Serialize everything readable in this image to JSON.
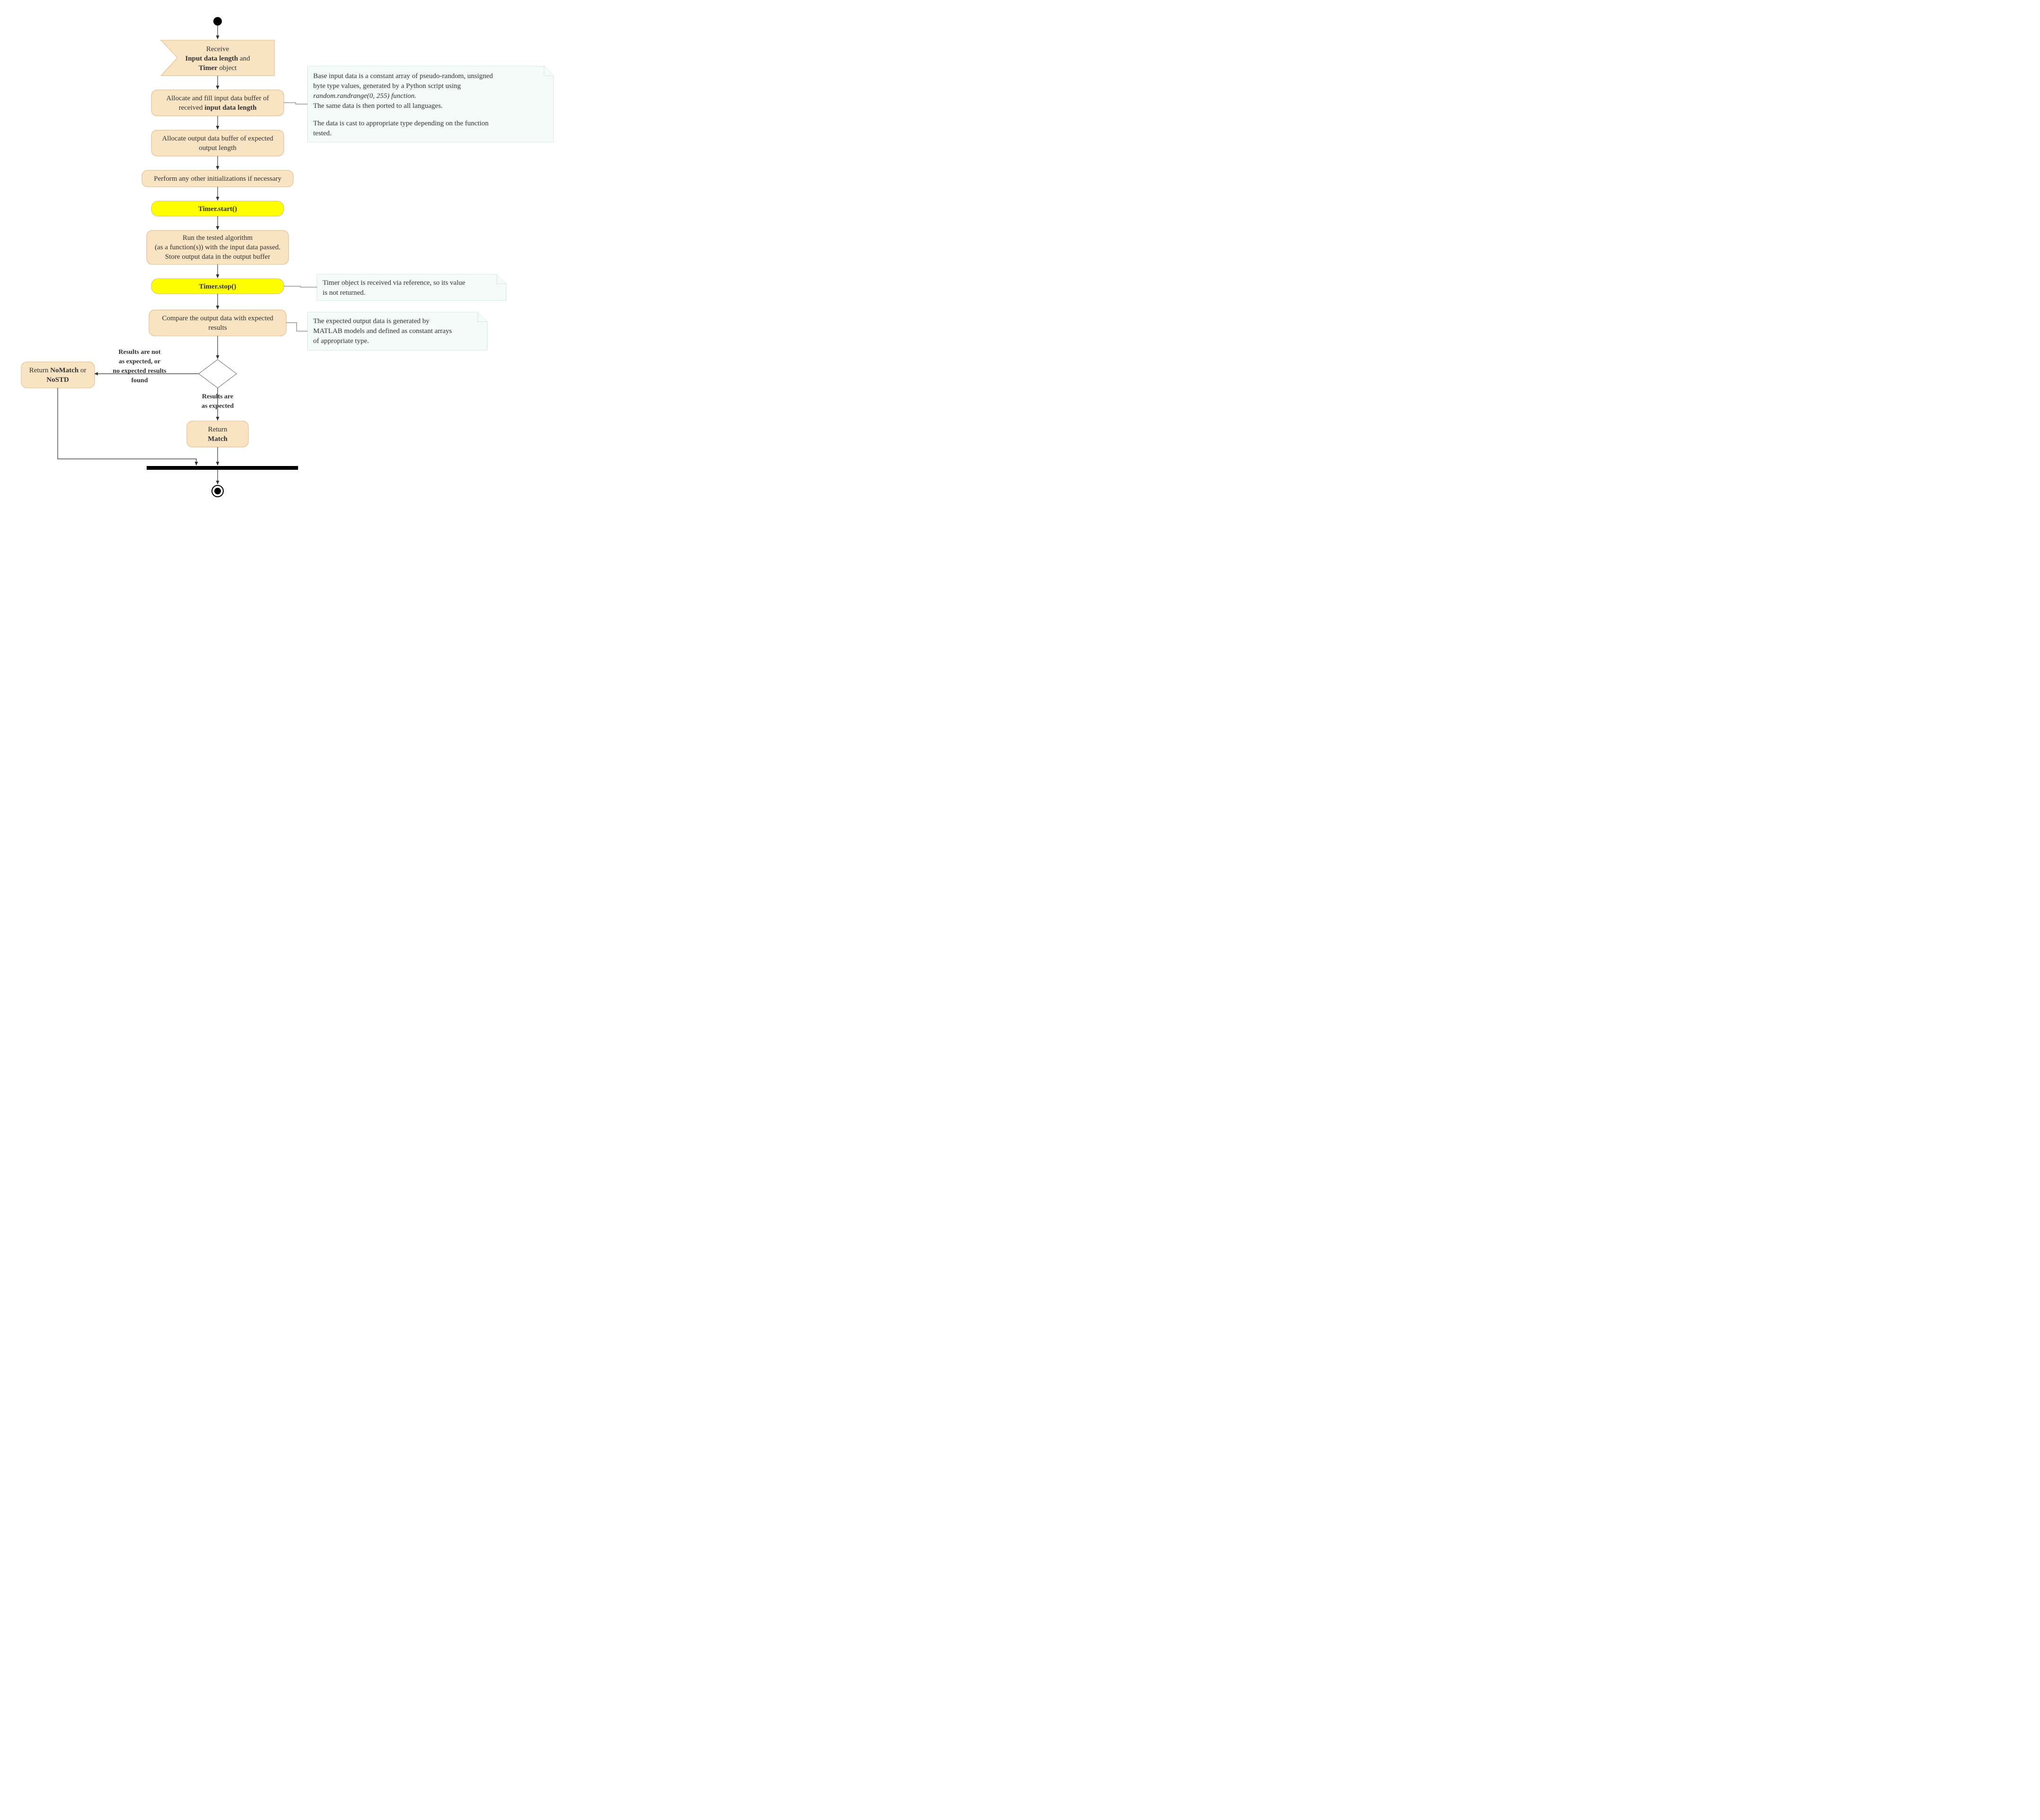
{
  "start_node": "●",
  "receive": {
    "line1": "Receive",
    "line2a": "Input data length",
    "line2b": " and",
    "line3a": "Timer",
    "line3b": " object"
  },
  "alloc_input": {
    "line1": "Allocate and fill input data buffer of",
    "line2a": "received ",
    "line2b": "input data length"
  },
  "alloc_output": {
    "line1": "Allocate output data buffer of expected",
    "line2": "output length"
  },
  "other_init": "Perform any other initializations if necessary",
  "timer_start": "Timer.start()",
  "run_algo": {
    "line1": "Run the tested algorithm",
    "line2": "(as a function(s)) with the input data passed.",
    "line3": "Store output data in the output buffer"
  },
  "timer_stop": "Timer.stop()",
  "compare": {
    "line1": "Compare the output data with expected",
    "line2": "results"
  },
  "decision_left": {
    "line1": "Results are not",
    "line2": "as expected, or",
    "line3": "no expected results",
    "line4": "found"
  },
  "decision_down": {
    "line1": "Results are",
    "line2": "as expected"
  },
  "return_nomatch": {
    "line1a": "Return ",
    "line1b": "NoMatch",
    "line1c": " or",
    "line2": "NoSTD"
  },
  "return_match": {
    "line1": "Return",
    "line2": "Match"
  },
  "note1": {
    "line1": "Base input data is a constant array of pseudo-random, unsigned",
    "line2": "byte type values, generated by a Python script using",
    "line3": "random.randrange(0, 255) function.",
    "line4": "The same data is then ported to all languages.",
    "line5": "The data is cast to appropriate type depending on the function",
    "line6": "tested."
  },
  "note2": {
    "line1": "Timer object is received via reference, so its value",
    "line2": "is not returned."
  },
  "note3": {
    "line1": "The expected output data is generated by",
    "line2": "MATLAB models and defined as constant arrays",
    "line3": "of appropriate type."
  }
}
